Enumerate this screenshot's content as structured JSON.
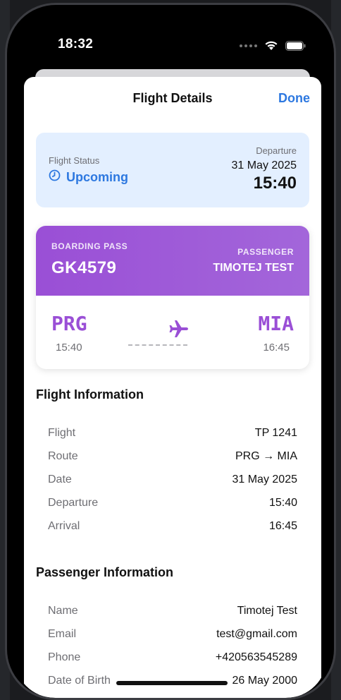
{
  "status_bar": {
    "time": "18:32"
  },
  "nav": {
    "title": "Flight Details",
    "done_label": "Done"
  },
  "status_card": {
    "status_label": "Flight Status",
    "status_value": "Upcoming",
    "departure_label": "Departure",
    "departure_date": "31 May 2025",
    "departure_time": "15:40"
  },
  "boarding_pass": {
    "header_label": "BOARDING PASS",
    "code": "GK4579",
    "passenger_label": "PASSENGER",
    "passenger_name": "TIMOTEJ TEST",
    "origin_code": "PRG",
    "origin_time": "15:40",
    "destination_code": "MIA",
    "destination_time": "16:45",
    "icon": "airplane-icon"
  },
  "flight_info": {
    "title": "Flight Information",
    "rows": [
      {
        "label": "Flight",
        "value": "TP 1241"
      },
      {
        "label": "Route",
        "value": "PRG → MIA"
      },
      {
        "label": "Date",
        "value": "31 May 2025"
      },
      {
        "label": "Departure",
        "value": "15:40"
      },
      {
        "label": "Arrival",
        "value": "16:45"
      }
    ]
  },
  "passenger_info": {
    "title": "Passenger Information",
    "rows": [
      {
        "label": "Name",
        "value": "Timotej Test"
      },
      {
        "label": "Email",
        "value": "test@gmail.com"
      },
      {
        "label": "Phone",
        "value": "+420563545289"
      },
      {
        "label": "Date of Birth",
        "value": "26 May 2000"
      }
    ]
  },
  "colors": {
    "accent_blue": "#2d78e0",
    "accent_purple": "#9a4fd6",
    "status_bg": "#e3efff"
  }
}
